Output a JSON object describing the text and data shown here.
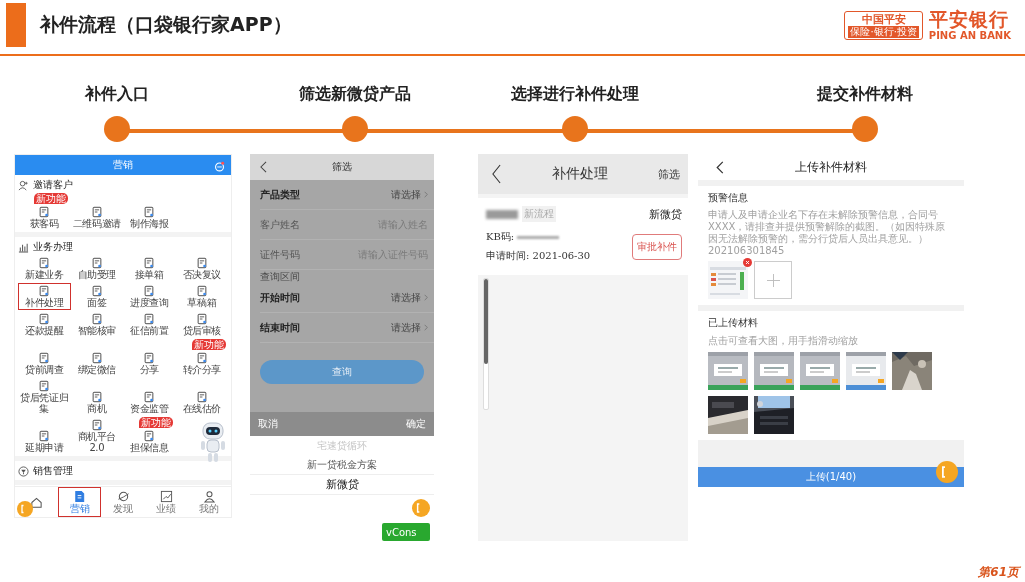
{
  "header": {
    "title": "补件流程（口袋银行家APP）",
    "logo": {
      "badge": "中国平安",
      "badge_sub": "保险·银行·投资",
      "name": "平安银行",
      "name_en": "PING AN BANK"
    }
  },
  "steps": [
    {
      "label": "补件入口"
    },
    {
      "label": "筛选新微贷产品"
    },
    {
      "label": "选择进行补件处理"
    },
    {
      "label": "提交补件材料"
    }
  ],
  "screen_entry": {
    "title": "营销",
    "sections": [
      {
        "title": "邀请客户",
        "kind": "person",
        "items": [
          {
            "label": "获客码",
            "badge": "新功能",
            "selected": false
          },
          {
            "label": "二维码邀请",
            "selected": false
          },
          {
            "label": "制作海报",
            "selected": false
          }
        ]
      },
      {
        "title": "业务办理",
        "kind": "chart",
        "items": [
          {
            "label": "新建业务",
            "selected": false
          },
          {
            "label": "自助受理",
            "selected": false
          },
          {
            "label": "接单箱",
            "selected": false
          },
          {
            "label": "否决复议",
            "selected": false
          },
          {
            "label": "补件处理",
            "selected": true
          },
          {
            "label": "面签",
            "selected": false
          },
          {
            "label": "进度查询",
            "selected": false
          },
          {
            "label": "草稿箱",
            "selected": false
          },
          {
            "label": "还款提醒",
            "selected": false
          },
          {
            "label": "智能核审",
            "selected": false
          },
          {
            "label": "征信前置",
            "selected": false
          },
          {
            "label": "贷后审核",
            "selected": false
          },
          {
            "label": "贷前调查",
            "selected": false
          },
          {
            "label": "绑定微信",
            "selected": false
          },
          {
            "label": "分享",
            "selected": false
          },
          {
            "label": "转介分享",
            "badge": "新功能",
            "selected": false
          },
          {
            "label": "贷后凭证归集",
            "selected": false
          },
          {
            "label": "商机",
            "selected": false
          },
          {
            "label": "资金监管",
            "selected": false
          },
          {
            "label": "在线估价",
            "selected": false
          },
          {
            "label": "延期申请",
            "selected": false
          },
          {
            "label": "商机平台2.0",
            "selected": false
          },
          {
            "label": "担保信息",
            "badge": "新功能",
            "selected": false
          }
        ]
      },
      {
        "title": "销售管理",
        "kind": "filter"
      }
    ],
    "nav": [
      {
        "kind": "home",
        "selected": false
      },
      {
        "kind": "doc",
        "label": "营销",
        "selected": true
      },
      {
        "kind": "planet",
        "label": "发现",
        "selected": false
      },
      {
        "kind": "chart",
        "label": "业绩",
        "selected": false
      },
      {
        "kind": "person",
        "label": "我的",
        "selected": false
      }
    ]
  },
  "screen_filter": {
    "title": "筛选",
    "fields": [
      {
        "kind": "select",
        "label": "产品类型",
        "placeholder": "请选择"
      },
      {
        "kind": "input",
        "label": "客户姓名",
        "placeholder": "请输入姓名"
      },
      {
        "kind": "input",
        "label": "证件号码",
        "placeholder": "请输入证件号码"
      },
      {
        "kind": "caption",
        "label": "查询区间"
      },
      {
        "kind": "select",
        "label": "开始时间",
        "placeholder": "请选择"
      },
      {
        "kind": "select",
        "label": "结束时间",
        "placeholder": "请选择"
      }
    ],
    "query_button": "查询",
    "cancel": "取消",
    "confirm": "确定",
    "options": [
      {
        "label": "宅速贷循环",
        "selected": false
      },
      {
        "label": "新一贷税金方案",
        "selected": false
      },
      {
        "label": "新微贷",
        "selected": true
      }
    ],
    "console_button": "vCons"
  },
  "screen_process": {
    "title": "补件处理",
    "filter": "筛选",
    "card": {
      "tag": "新流程",
      "product": "新微贷",
      "code_label": "KB码:",
      "date": "申请时间: 2021-06-30",
      "action": "审批补件"
    }
  },
  "screen_upload": {
    "title": "上传补件材料",
    "warning_title": "预警信息",
    "warning_text": "申请人及申请企业名下存在未解除预警信息，合同号XXXX，请排查并提供预警解除的截图。（如因特殊原因无法解除预警的，需分行贷后人员出具意见。）202106301845",
    "attachment": {
      "kind": "picture",
      "removable": true
    },
    "uploaded_title": "已上传材料",
    "uploaded_hint": "点击可查看大图，用手指滑动缩放",
    "uploaded": [
      {
        "kind": "picture"
      },
      {
        "kind": "picture"
      },
      {
        "kind": "picture"
      },
      {
        "kind": "picture"
      },
      {
        "kind": "picture"
      },
      {
        "kind": "picture"
      },
      {
        "kind": "picture"
      }
    ],
    "upload_button": "上传(1/40)"
  },
  "page_number": "第61页"
}
